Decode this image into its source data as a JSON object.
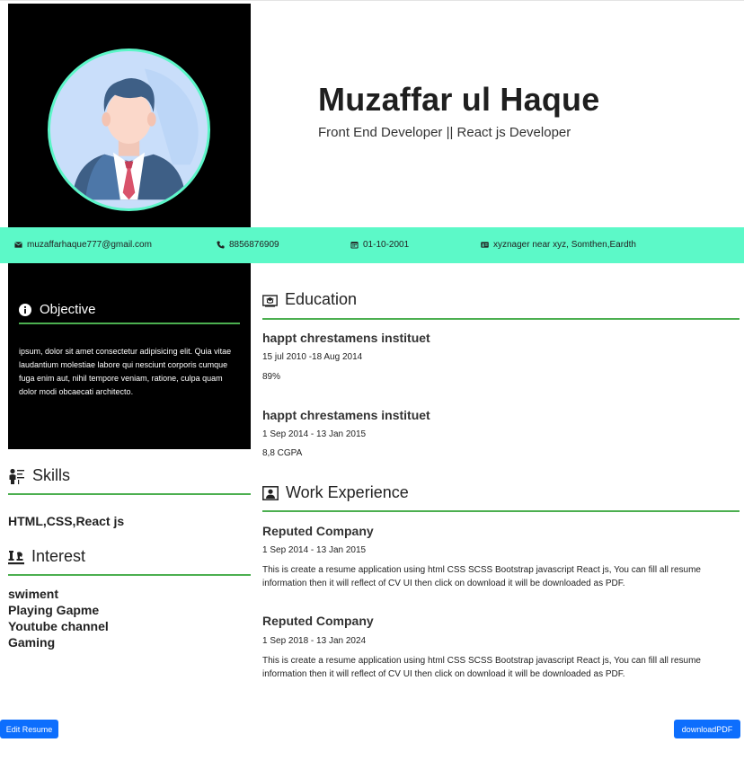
{
  "header": {
    "name": "Muzaffar ul Haque",
    "subtitle": "Front End Developer || React js Developer"
  },
  "contact": {
    "email": "muzaffarhaque777@gmail.com",
    "phone": "8856876909",
    "dob": "01-10-2001",
    "address": "xyznager near xyz, Somthen,Eardth"
  },
  "objective": {
    "heading": "Objective",
    "text": "ipsum, dolor sit amet consectetur adipisicing elit. Quia vitae laudantium molestiae labore qui nesciunt corporis cumque fuga enim aut, nihil tempore veniam, ratione, culpa quam dolor modi obcaecati architecto."
  },
  "skills": {
    "heading": "Skills",
    "text": "HTML,CSS,React js"
  },
  "interest": {
    "heading": "Interest",
    "items": [
      "swiment",
      "Playing Gapme",
      "Youtube channel",
      "Gaming"
    ]
  },
  "education": {
    "heading": "Education",
    "entries": [
      {
        "institute": "happt chrestamens instituet",
        "dates": "15 jul 2010 -18 Aug 2014",
        "score": "89%"
      },
      {
        "institute": "happt chrestamens instituet",
        "dates": "1 Sep 2014 - 13 Jan 2015",
        "score": "8,8 CGPA"
      }
    ]
  },
  "experience": {
    "heading": "Work Experience",
    "entries": [
      {
        "company": "Reputed Company",
        "dates": "1 Sep 2014 - 13 Jan 2015",
        "description": "This is create a resume application using html CSS SCSS Bootstrap javascript React js, You can fill all resume information then it will reflect of CV UI then click on download it will be downloaded as PDF."
      },
      {
        "company": "Reputed Company",
        "dates": "1 Sep 2018 - 13 Jan 2024",
        "description": "This is create a resume application using html CSS SCSS Bootstrap javascript React js, You can fill all resume information then it will reflect of CV UI then click on download it will be downloaded as PDF."
      }
    ]
  },
  "actions": {
    "edit_label": "Edit Resume",
    "download_label": "downloadPDF"
  },
  "colors": {
    "accent": "#5cf9c8",
    "divider": "#4caf50",
    "button": "#0d6efd"
  },
  "icons": {
    "email": "envelope-icon",
    "phone": "phone-icon",
    "dob": "calendar-icon",
    "address": "id-card-icon",
    "objective": "info-icon",
    "education": "graduation-icon",
    "skills": "presenter-icon",
    "interest": "chess-icon",
    "experience": "portrait-icon"
  }
}
